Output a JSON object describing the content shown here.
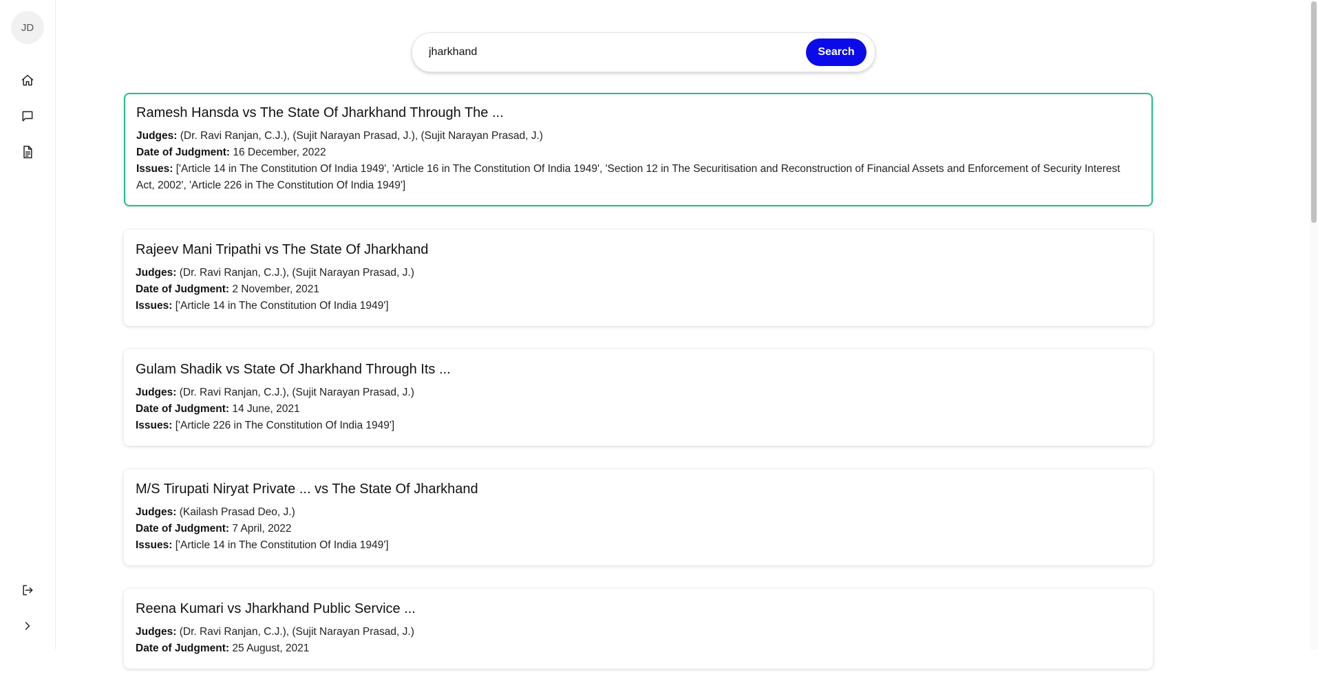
{
  "sidebar": {
    "avatar_initials": "JD",
    "nav": [
      {
        "icon": "home-icon"
      },
      {
        "icon": "chat-icon"
      },
      {
        "icon": "document-icon"
      }
    ],
    "bottom": [
      {
        "icon": "logout-icon"
      },
      {
        "icon": "chevron-right-icon"
      }
    ]
  },
  "search": {
    "value": "jharkhand",
    "placeholder": "",
    "button_label": "Search"
  },
  "labels": {
    "judges": "Judges:",
    "date": "Date of Judgment:",
    "issues": "Issues:"
  },
  "results": [
    {
      "title": "Ramesh Hansda vs The State Of Jharkhand Through The ...",
      "judges": "(Dr. Ravi Ranjan, C.J.), (Sujit Narayan Prasad, J.), (Sujit Narayan Prasad, J.)",
      "date": "16 December, 2022",
      "issues": "['Article 14 in The Constitution Of India 1949', 'Article 16 in The Constitution Of India 1949', 'Section 12 in The Securitisation and Reconstruction of Financial Assets and Enforcement of Security Interest Act, 2002', 'Article 226 in The Constitution Of India 1949']"
    },
    {
      "title": "Rajeev Mani Tripathi vs The State Of Jharkhand",
      "judges": "(Dr. Ravi Ranjan, C.J.), (Sujit Narayan Prasad, J.)",
      "date": "2 November, 2021",
      "issues": "['Article 14 in The Constitution Of India 1949']"
    },
    {
      "title": "Gulam Shadik vs State Of Jharkhand Through Its ...",
      "judges": "(Dr. Ravi Ranjan, C.J.), (Sujit Narayan Prasad, J.)",
      "date": "14 June, 2021",
      "issues": "['Article 226 in The Constitution Of India 1949']"
    },
    {
      "title": "M/S Tirupati Niryat Private ... vs The State Of Jharkhand",
      "judges": "(Kailash Prasad Deo, J.)",
      "date": "7 April, 2022",
      "issues": "['Article 14 in The Constitution Of India 1949']"
    },
    {
      "title": "Reena Kumari vs Jharkhand Public Service ...",
      "judges": "(Dr. Ravi Ranjan, C.J.), (Sujit Narayan Prasad, J.)",
      "date": "25 August, 2021",
      "issues": ""
    }
  ],
  "colors": {
    "accent": "#0b0bea",
    "active_border": "#21c08b"
  }
}
